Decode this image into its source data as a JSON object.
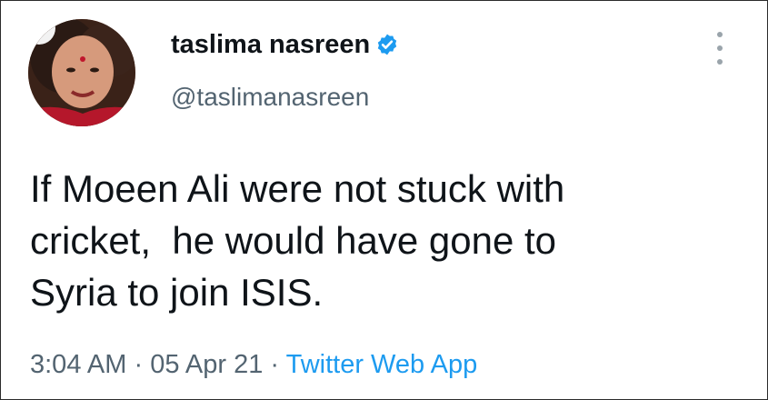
{
  "author": {
    "display_name": "taslima nasreen",
    "handle": "@taslimanasreen",
    "verified": true
  },
  "tweet": {
    "lines": [
      "If Moeen Ali were not stuck with",
      "cricket,  he would have gone to",
      "Syria to join ISIS."
    ]
  },
  "meta": {
    "time": "3:04 AM",
    "separator": " · ",
    "date": "05 Apr 21",
    "source": "Twitter Web App"
  },
  "icons": {
    "verified": "verified-badge-icon",
    "more": "more-options-icon"
  },
  "colors": {
    "text": "#0f1419",
    "secondary": "#536471",
    "accent": "#1d9bf0"
  }
}
